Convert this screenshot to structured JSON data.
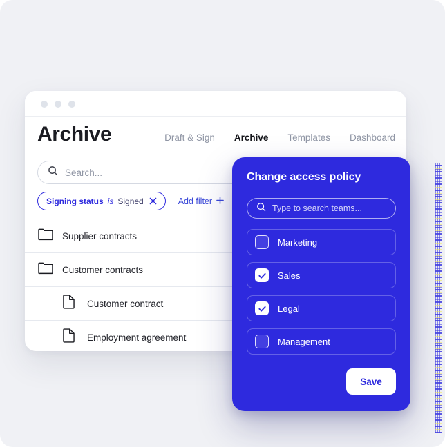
{
  "window": {
    "traffic_lights": [
      "dot-1",
      "dot-2",
      "dot-3"
    ]
  },
  "header": {
    "title": "Archive"
  },
  "nav": {
    "items": [
      {
        "label": "Draft & Sign",
        "active": false
      },
      {
        "label": "Archive",
        "active": true
      },
      {
        "label": "Templates",
        "active": false
      },
      {
        "label": "Dashboard",
        "active": false
      }
    ]
  },
  "search": {
    "icon": "search-icon",
    "placeholder": "Search...",
    "value": ""
  },
  "filters": {
    "chip": {
      "key": "Signing status",
      "operator": "is",
      "value": "Signed",
      "remove_icon": "close-icon"
    },
    "add_filter": {
      "label": "Add filter",
      "icon": "plus-icon"
    }
  },
  "file_list": {
    "rows": [
      {
        "name": "Supplier contracts",
        "icon": "folder-icon",
        "indent": false
      },
      {
        "name": "Customer contracts",
        "icon": "folder-icon",
        "indent": false
      },
      {
        "name": "Customer contract",
        "icon": "document-icon",
        "indent": true
      },
      {
        "name": "Employment agreement",
        "icon": "document-icon",
        "indent": true
      }
    ]
  },
  "modal": {
    "title": "Change access policy",
    "search": {
      "icon": "search-icon",
      "placeholder": "Type to search teams...",
      "value": ""
    },
    "teams": [
      {
        "label": "Marketing",
        "checked": false
      },
      {
        "label": "Sales",
        "checked": true
      },
      {
        "label": "Legal",
        "checked": true
      },
      {
        "label": "Management",
        "checked": false
      }
    ],
    "save_label": "Save"
  },
  "colors": {
    "brand_blue": "#2e2ade",
    "chip_blue": "#2e2ade",
    "link_blue": "#3b49d8",
    "page_background": "#f0f1f5",
    "card_white": "#ffffff",
    "text_dark": "#1b1c22",
    "text_muted": "#9096a5",
    "divider": "#e6e9ef"
  }
}
